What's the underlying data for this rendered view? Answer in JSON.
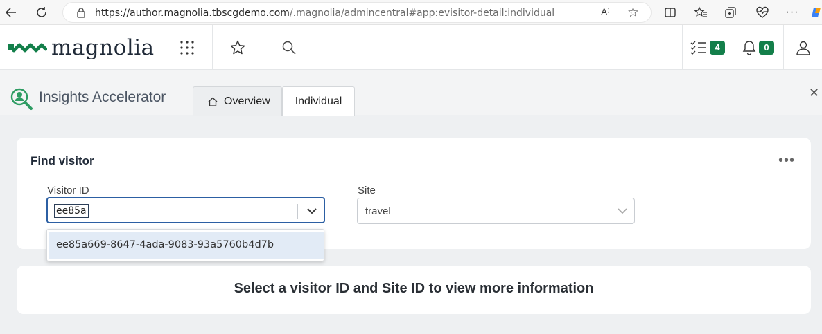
{
  "browser": {
    "url_main": "https://author.magnolia.tbscgdemo.com",
    "url_rest": "/.magnolia/admincentral#app:evisitor-detail:individual",
    "read_aloud": "A⁾"
  },
  "header": {
    "logo_text": "magnolia",
    "tasks_count": "4",
    "notifications_count": "0"
  },
  "app": {
    "title": "Insights Accelerator",
    "tabs": [
      {
        "label": "Overview"
      },
      {
        "label": "Individual"
      }
    ]
  },
  "find_visitor": {
    "title": "Find visitor",
    "more": "•••",
    "visitor_id_label": "Visitor ID",
    "visitor_id_value": "ee85a",
    "site_label": "Site",
    "site_value": "travel",
    "suggestion": "ee85a669-8647-4ada-9083-93a5760b4d7b"
  },
  "info_card": {
    "message": "Select a visitor ID and Site ID to view more information"
  },
  "colors": {
    "brand_green": "#137f4a",
    "focus_blue": "#2c5fa3",
    "highlight": "#e2ebf6"
  }
}
